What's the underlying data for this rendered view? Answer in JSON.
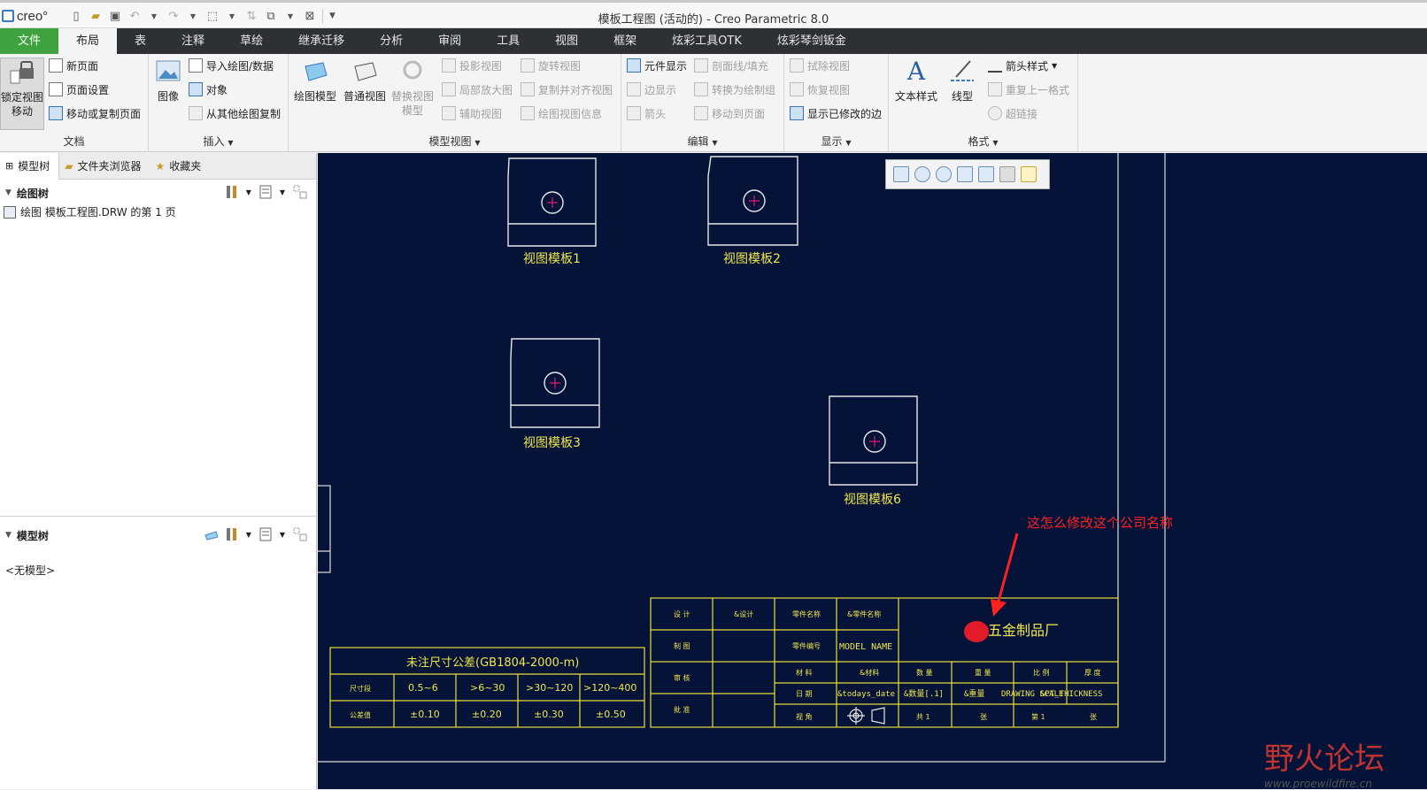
{
  "app": {
    "logo_text": "creo°",
    "window_title": "模板工程图 (活动的) - Creo Parametric 8.0"
  },
  "tabs": [
    "文件",
    "布局",
    "表",
    "注释",
    "草绘",
    "继承迁移",
    "分析",
    "审阅",
    "工具",
    "视图",
    "框架",
    "炫彩工具OTK",
    "炫彩琴剑钣金"
  ],
  "ribbon": {
    "doc": {
      "lock_view": "锁定视图\n移动",
      "new_page": "新页面",
      "page_setup": "页面设置",
      "move_copy_page": "移动或复制页面",
      "label": "文档"
    },
    "insert": {
      "image": "图像",
      "import": "导入绘图/数据",
      "object": "对象",
      "copy_from": "从其他绘图复制",
      "label": "插入"
    },
    "model_views": {
      "drawing_model": "绘图模型",
      "general_view": "普通视图",
      "replace_view": "替换视图\n模型",
      "projection": "投影视图",
      "detailed": "局部放大图",
      "auxiliary": "辅助视图",
      "revolved": "旋转视图",
      "copy_align": "复制并对齐视图",
      "view_info": "绘图视图信息",
      "label": "模型视图"
    },
    "edit": {
      "component_display": "元件显示",
      "edge_display": "边显示",
      "arrows": "箭头",
      "xsection": "剖面线/填充",
      "convert": "转换为绘制组",
      "move_to_page": "移动到页面",
      "label": "编辑"
    },
    "display": {
      "erase_view": "拭除视图",
      "resume_view": "恢复视图",
      "show_modified": "显示已修改的边",
      "label": "显示"
    },
    "format": {
      "text_style": "文本样式",
      "line_style": "线型",
      "arrow_style": "箭头样式",
      "repeat_last": "重复上一格式",
      "hyperlink": "超链接",
      "label": "格式"
    }
  },
  "left_panel": {
    "tabs": [
      "模型树",
      "文件夹浏览器",
      "收藏夹"
    ],
    "drawing_tree_title": "绘图树",
    "drawing_tree_item": "绘图 模板工程图.DRW 的第 1 页",
    "model_tree_title": "模型树",
    "model_tree_empty": "<无模型>"
  },
  "drawing": {
    "views": [
      {
        "label": "视图模板1"
      },
      {
        "label": "视图模板2"
      },
      {
        "label": "视图模板3"
      },
      {
        "label": "视图模板6"
      }
    ],
    "title_block": {
      "design": "设 计",
      "design_val": "&设计",
      "draw": "制 图",
      "check": "审 核",
      "approve": "批 准",
      "part_name": "零件名称",
      "part_name_val": "&零件名称",
      "part_no": "零件编号",
      "part_no_val": "MODEL NAME",
      "material": "材 料",
      "material_val": "&材料",
      "date": "日 期",
      "date_val": "&todays_date",
      "view": "视 角",
      "qty": "数 量",
      "qty_val": "&数量[.1]",
      "weight": "重 量",
      "weight_val": "&重量",
      "scale": "比 例",
      "scale_val": "DRAWING SCALE",
      "thickness": "厚 度",
      "thickness_val": "&PT_THICKNESS",
      "sheet_total": "共 1",
      "sheet_unit": "张",
      "sheet_no": "第 1",
      "sheet_unit2": "张",
      "company": "五金制品厂"
    },
    "tolerance": {
      "title": "未注尺寸公差(GB1804-2000-m)",
      "row1_head": "尺寸段",
      "row2_head": "公差值",
      "ranges": [
        "0.5~6",
        ">6~30",
        ">30~120",
        ">120~400"
      ],
      "values": [
        "±0.10",
        "±0.20",
        "±0.30",
        "±0.50"
      ]
    }
  },
  "annotation": "这怎么修改这个公司名称",
  "watermark": {
    "cn": "野火论坛",
    "url": "www.proewildfire.cn"
  }
}
